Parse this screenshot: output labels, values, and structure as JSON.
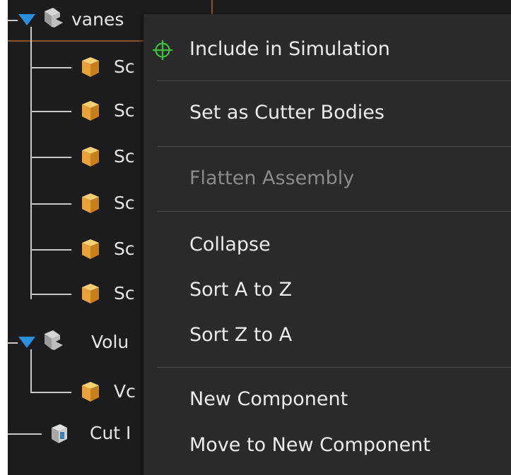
{
  "tree": {
    "items": [
      {
        "label": "vanes",
        "kind": "assembly"
      },
      {
        "label": "Sc",
        "kind": "part"
      },
      {
        "label": "Sc",
        "kind": "part"
      },
      {
        "label": "Sc",
        "kind": "part"
      },
      {
        "label": "Sc",
        "kind": "part"
      },
      {
        "label": "Sc",
        "kind": "part"
      },
      {
        "label": "Sc",
        "kind": "part"
      },
      {
        "label": "Volu",
        "kind": "assembly"
      },
      {
        "label": "Vc",
        "kind": "part"
      },
      {
        "label": "Cut I",
        "kind": "cutter"
      }
    ]
  },
  "context_menu": {
    "include_in_simulation": "Include in Simulation",
    "set_as_cutter_bodies": "Set as Cutter Bodies",
    "flatten_assembly": "Flatten Assembly",
    "collapse": "Collapse",
    "sort_a_to_z": "Sort A to Z",
    "sort_z_to_a": "Sort Z to A",
    "new_component": "New Component",
    "move_to_new_component": "Move to New Component"
  },
  "colors": {
    "background": "#1c1c1e",
    "menu_background": "#2a2a2c",
    "text": "#ececec",
    "disabled_text": "#8a8a8a",
    "accent_arrow": "#2b8fe0",
    "part_icon": "#e8a23c",
    "target_icon": "#3fbf3f",
    "selection": "#8a5226"
  },
  "icons": {
    "include": "crosshair-target-icon",
    "assembly": "component-stack-icon",
    "part": "cube-icon",
    "cutter": "cutter-body-icon",
    "expand": "triangle-down-icon"
  }
}
